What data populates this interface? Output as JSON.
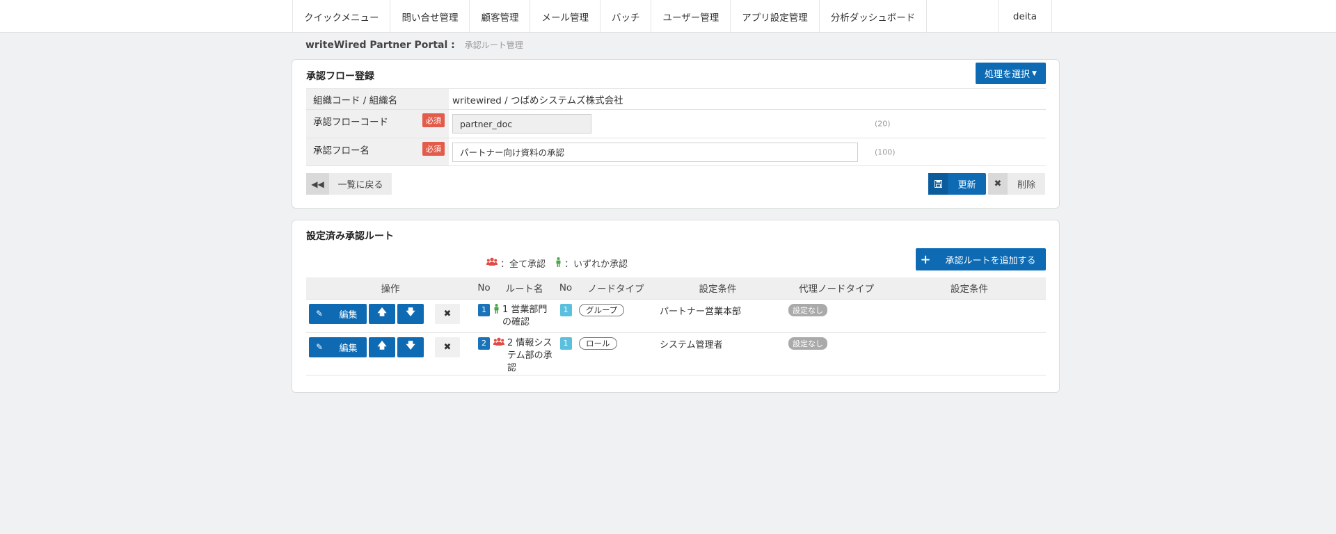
{
  "nav": {
    "items": [
      "クイックメニュー",
      "問い合せ管理",
      "顧客管理",
      "メール管理",
      "バッチ",
      "ユーザー管理",
      "アプリ設定管理",
      "分析ダッシュボード"
    ],
    "user": "deita"
  },
  "breadcrumb": {
    "portal": "writeWired Partner Portal :",
    "page": "承認ルート管理"
  },
  "form_panel": {
    "title": "承認フロー登録",
    "action_button": "処理を選択",
    "rows": [
      {
        "label": "組織コード / 組織名",
        "value": "writewired / つばめシステムズ株式会社"
      },
      {
        "label": "承認フローコード",
        "required": "必須",
        "value": "partner_doc",
        "hint": "(20)"
      },
      {
        "label": "承認フロー名",
        "required": "必須",
        "value": "パートナー向け資料の承認",
        "hint": "(100)"
      }
    ],
    "back_button": "一覧に戻る",
    "update_button": "更新",
    "delete_button": "削除"
  },
  "route_panel": {
    "title": "設定済み承認ルート",
    "legend_all": "：全て承認",
    "legend_any": "：いずれか承認",
    "add_button": "承認ルートを追加する",
    "headers": [
      "操作",
      "No",
      "ルート名",
      "No",
      "ノードタイプ",
      "設定条件",
      "代理ノードタイプ",
      "設定条件"
    ],
    "edit_label": "編集",
    "rows": [
      {
        "no": "1",
        "type_icon": "person-icon",
        "route_name": "1 営業部門の確認",
        "node_no": "1",
        "node_type": "グループ",
        "condition": "パートナー営業本部",
        "proxy_type": "設定なし",
        "proxy_condition": ""
      },
      {
        "no": "2",
        "type_icon": "group-icon",
        "route_name": "2 情報システム部の承認",
        "node_no": "1",
        "node_type": "ロール",
        "condition": "システム管理者",
        "proxy_type": "設定なし",
        "proxy_condition": ""
      }
    ]
  }
}
